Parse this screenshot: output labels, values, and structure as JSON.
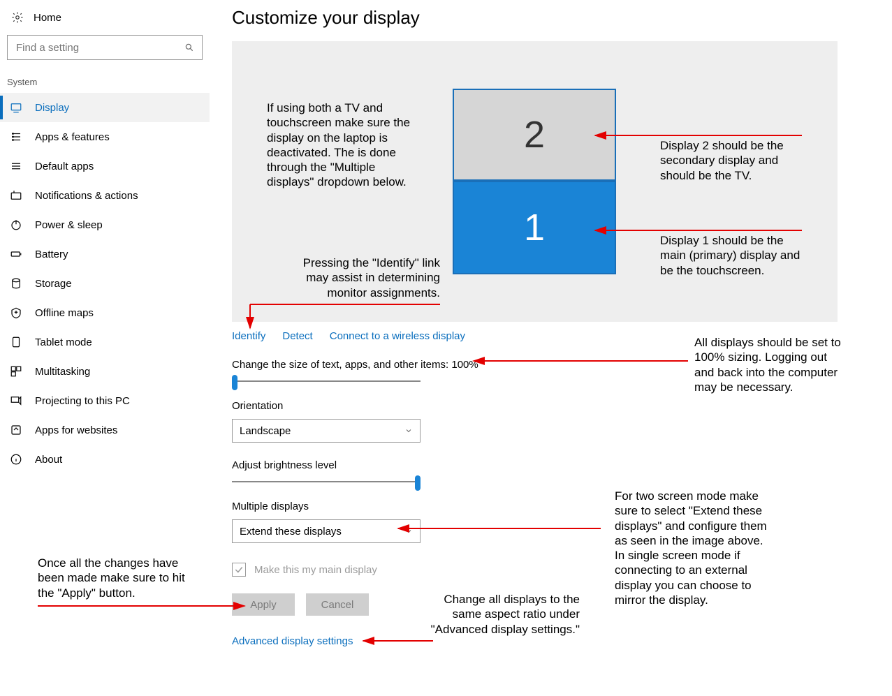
{
  "home_label": "Home",
  "search_placeholder": "Find a setting",
  "section_label": "System",
  "nav": [
    {
      "label": "Display",
      "selected": true
    },
    {
      "label": "Apps & features"
    },
    {
      "label": "Default apps"
    },
    {
      "label": "Notifications & actions"
    },
    {
      "label": "Power & sleep"
    },
    {
      "label": "Battery"
    },
    {
      "label": "Storage"
    },
    {
      "label": "Offline maps"
    },
    {
      "label": "Tablet mode"
    },
    {
      "label": "Multitasking"
    },
    {
      "label": "Projecting to this PC"
    },
    {
      "label": "Apps for websites"
    },
    {
      "label": "About"
    }
  ],
  "page_title": "Customize your display",
  "monitor1": "1",
  "monitor2": "2",
  "links": {
    "identify": "Identify",
    "detect": "Detect",
    "wireless": "Connect to a wireless display"
  },
  "size_label": "Change the size of text, apps, and other items: 100%",
  "orientation_label": "Orientation",
  "orientation_value": "Landscape",
  "brightness_label": "Adjust brightness level",
  "multi_label": "Multiple displays",
  "multi_value": "Extend these displays",
  "main_display_cb": "Make this my main display",
  "apply": "Apply",
  "cancel": "Cancel",
  "advanced": "Advanced display settings",
  "annotations": {
    "a1": "If using both a TV and touchscreen make sure the display on the laptop is deactivated.  The is done through the \"Multiple displays\" dropdown below.",
    "a2": "Pressing the \"Identify\" link may assist in determining monitor assignments.",
    "a3": "Display 2 should be the secondary display and should be the TV.",
    "a4": "Display 1 should be the main (primary) display and be the touchscreen.",
    "a5": "All displays should be set to 100% sizing.  Logging out and back into the computer may be necessary.",
    "a6": "For two screen mode make sure to select \"Extend these displays\" and configure them as seen in the image above.  In single screen mode if connecting to an external display you can choose to mirror the display.",
    "a7": "Change all displays to the same aspect ratio under \"Advanced display settings.\"",
    "a8": "Once all the changes have been made make sure to hit the \"Apply\" button."
  }
}
